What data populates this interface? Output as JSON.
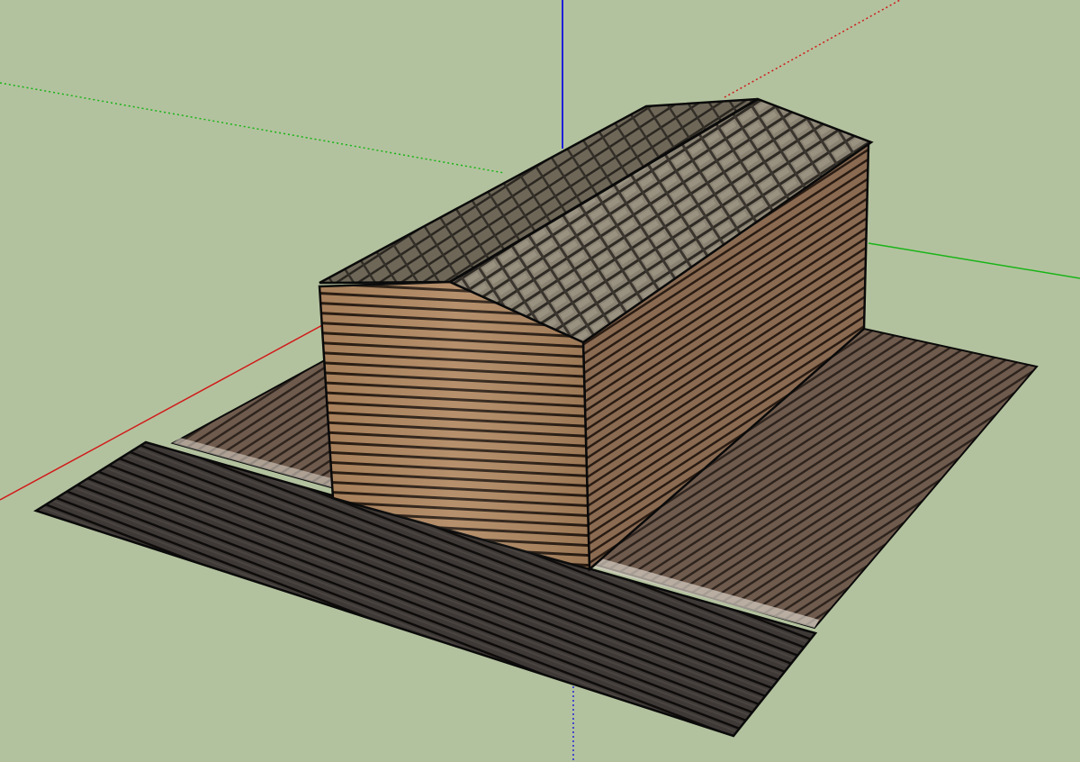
{
  "viewport": {
    "label": "",
    "background": "#b3c29e"
  },
  "axes": {
    "red_color": "#d01a1a",
    "green_color": "#18b418",
    "blue_color": "#1f1fd8"
  },
  "model": {
    "roof_color": "#7a7264",
    "wall_front_color": "#b08760",
    "wall_side_color": "#8a6b52",
    "deck_color": "#6f5b4d",
    "walkway_color": "#3a3633",
    "edge_color": "#0a0a0a"
  }
}
